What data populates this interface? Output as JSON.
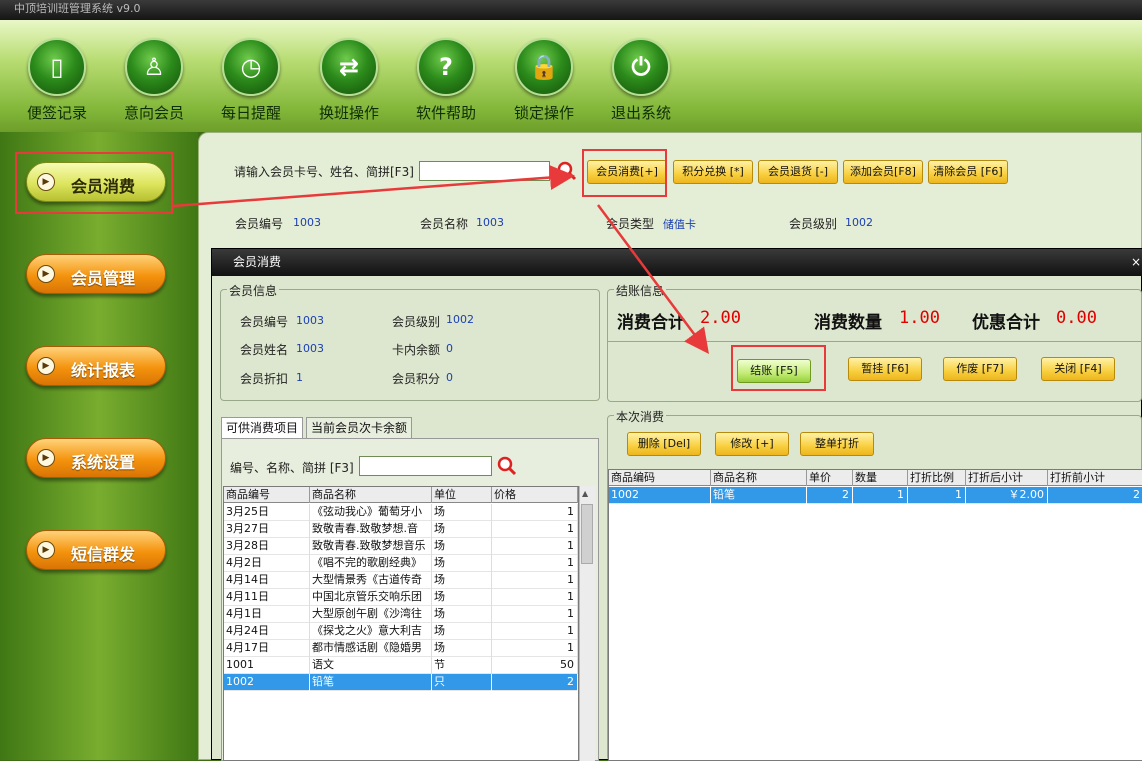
{
  "app": {
    "title": "中顶培训班管理系统  v9.0"
  },
  "toolbar": [
    {
      "label": "便签记录",
      "icon": "note-icon",
      "glyph": "▯"
    },
    {
      "label": "意向会员",
      "icon": "person-icon",
      "glyph": "♙"
    },
    {
      "label": "每日提醒",
      "icon": "alarm-clock-icon",
      "glyph": "◷"
    },
    {
      "label": "换班操作",
      "icon": "swap-arrows-icon",
      "glyph": "⇄"
    },
    {
      "label": "软件帮助",
      "icon": "help-icon",
      "glyph": "?"
    },
    {
      "label": "锁定操作",
      "icon": "lock-icon",
      "glyph": "🔒"
    },
    {
      "label": "退出系统",
      "icon": "power-icon",
      "glyph": "⏻"
    }
  ],
  "sidebar": [
    {
      "label": "会员消费",
      "active": true
    },
    {
      "label": "会员管理",
      "active": false
    },
    {
      "label": "统计报表",
      "active": false
    },
    {
      "label": "系统设置",
      "active": false
    },
    {
      "label": "短信群发",
      "active": false
    }
  ],
  "search": {
    "label": "请输入会员卡号、姓名、简拼[F3]",
    "value": ""
  },
  "actions": [
    "会员消费[+]",
    "积分兑换 [*]",
    "会员退货 [-]",
    "添加会员[F8]",
    "清除会员 [F6]"
  ],
  "member": {
    "no_label": "会员编号",
    "no": "1003",
    "name_label": "会员名称",
    "name": "1003",
    "type_label": "会员类型",
    "type": "储值卡",
    "level_label": "会员级别",
    "level": "1002"
  },
  "dialog": {
    "title": "会员消费",
    "info": {
      "group": "会员信息",
      "no_label": "会员编号",
      "no": "1003",
      "level_label": "会员级别",
      "level": "1002",
      "name_label": "会员姓名",
      "name": "1003",
      "balance_label": "卡内余额",
      "balance": "0",
      "discount_label": "会员折扣",
      "discount": "1",
      "points_label": "会员积分",
      "points": "0"
    },
    "checkout": {
      "group": "结账信息",
      "total_label": "消费合计",
      "total": "2.00",
      "qty_label": "消费数量",
      "qty": "1.00",
      "discount_label": "优惠合计",
      "discount": "0.00",
      "buttons": [
        "结账 [F5]",
        "暂挂 [F6]",
        "作废 [F7]",
        "关闭 [F4]"
      ]
    },
    "tabs": [
      "可供消费项目",
      "当前会员次卡余额"
    ],
    "product_search": {
      "label": "编号、名称、简拼 [F3]",
      "value": ""
    },
    "products": {
      "columns": [
        "商品编号",
        "商品名称",
        "单位",
        "价格"
      ],
      "rows": [
        [
          "3月25日",
          "《弦动我心》葡萄牙小",
          "场",
          "1"
        ],
        [
          "3月27日",
          "致敬青春.致敬梦想.音",
          "场",
          "1"
        ],
        [
          "3月28日",
          "致敬青春.致敬梦想音乐",
          "场",
          "1"
        ],
        [
          "4月2日",
          "《唱不完的歌剧经典》",
          "场",
          "1"
        ],
        [
          "4月14日",
          "大型情景秀《古道传奇",
          "场",
          "1"
        ],
        [
          "4月11日",
          "中国北京管乐交响乐团",
          "场",
          "1"
        ],
        [
          "4月1日",
          "大型原创午剧《沙湾往",
          "场",
          "1"
        ],
        [
          "4月24日",
          "《探戈之火》意大利吉",
          "场",
          "1"
        ],
        [
          "4月17日",
          "都市情感话剧《隐婚男",
          "场",
          "1"
        ],
        [
          "1001",
          "语文",
          "节",
          "50"
        ],
        [
          "1002",
          "铅笔",
          "只",
          "2"
        ]
      ],
      "selected_row": 10
    },
    "current": {
      "group": "本次消费",
      "buttons": [
        "删除 [Del]",
        "修改 [+]",
        "整单打折"
      ],
      "columns": [
        "商品编码",
        "商品名称",
        "单价",
        "数量",
        "打折比例",
        "打折后小计",
        "打折前小计"
      ],
      "rows": [
        [
          "1002",
          "铅笔",
          "2",
          "1",
          "1",
          "￥2.00",
          "2"
        ]
      ]
    }
  },
  "colors": {
    "annotation_red": "#e83a3a",
    "price_red": "#e10000",
    "selected_blue": "#3199e8"
  }
}
